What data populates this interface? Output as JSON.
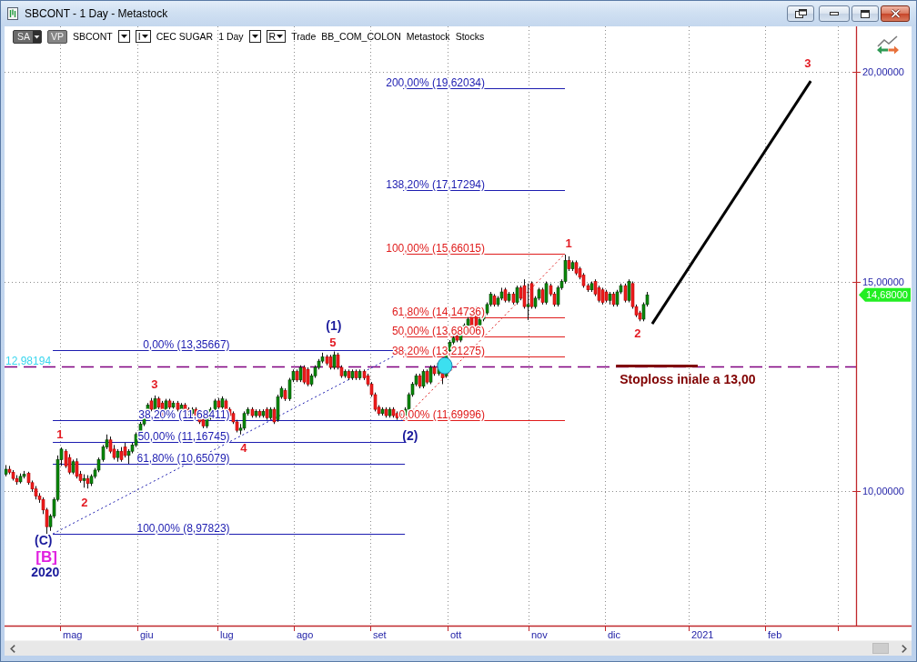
{
  "window": {
    "title": "SBCONT - 1 Day - Metastock"
  },
  "toolbar": [
    {
      "kind": "dark_menu",
      "label": "SA"
    },
    {
      "kind": "tag",
      "label": "VP"
    },
    {
      "kind": "text",
      "label": "SBCONT"
    },
    {
      "kind": "dropdown"
    },
    {
      "kind": "menu",
      "label": "I"
    },
    {
      "kind": "text",
      "label": "CEC SUGAR"
    },
    {
      "kind": "text",
      "label": "1 Day"
    },
    {
      "kind": "dropdown"
    },
    {
      "kind": "menu",
      "label": "R"
    },
    {
      "kind": "text",
      "label": "Trade"
    },
    {
      "kind": "text",
      "label": "BB_COM_COLON"
    },
    {
      "kind": "text",
      "label": "Metastock"
    },
    {
      "kind": "text",
      "label": "Stocks"
    }
  ],
  "chart": {
    "price_axis": {
      "labels": [
        "20,00000",
        "15,00000",
        "10,00000"
      ],
      "last_price": "14,68000"
    },
    "reference_line": {
      "label": "12,98194"
    },
    "fibonacci": [
      {
        "color": "#1c1cb0",
        "levels": [
          {
            "label": "0,00% (13,35667)",
            "color": "#1c1cb0"
          },
          {
            "label": "38,20% (11,68411)",
            "color": "#1c1cb0"
          },
          {
            "label": "50,00% (11,16745)",
            "color": "#1c1cb0"
          },
          {
            "label": "61,80% (10,65079)",
            "color": "#1c1cb0"
          },
          {
            "label": "100,00% (8,97823)",
            "color": "#1c1cb0"
          }
        ]
      },
      {
        "color": "#e01c1c",
        "levels": [
          {
            "label": "200,00% (19,62034)",
            "color": "#1c1cb0"
          },
          {
            "label": "138,20% (17,17294)",
            "color": "#1c1cb0"
          },
          {
            "label": "100,00% (15,66015)",
            "color": "#e01c1c"
          },
          {
            "label": "61,80% (14,14736)",
            "color": "#e01c1c"
          },
          {
            "label": "50,00% (13,68006)",
            "color": "#e01c1c"
          },
          {
            "label": "38,20% (13,21275)",
            "color": "#e01c1c"
          },
          {
            "label": "0,00% (11,69996)",
            "color": "#e01c1c"
          }
        ]
      }
    ],
    "wave_labels": [
      {
        "kind": "intermediate",
        "text": "(C)",
        "color": "#1a1a9c"
      },
      {
        "kind": "primary",
        "text": "[B]",
        "color": "#e020e0"
      },
      {
        "kind": "year",
        "text": "2020",
        "color": "#1a1a9c"
      },
      {
        "kind": "minor",
        "text": "1",
        "color": "#e31b23"
      },
      {
        "kind": "minor",
        "text": "2",
        "color": "#e31b23"
      },
      {
        "kind": "minor",
        "text": "3",
        "color": "#e31b23"
      },
      {
        "kind": "minor",
        "text": "4",
        "color": "#e31b23"
      },
      {
        "kind": "minor",
        "text": "5",
        "color": "#e31b23"
      },
      {
        "kind": "intermediate",
        "text": "(1)",
        "color": "#1a1a9c"
      },
      {
        "kind": "intermediate",
        "text": "(2)",
        "color": "#1a1a9c"
      },
      {
        "kind": "minor",
        "text": "1",
        "color": "#e31b23"
      },
      {
        "kind": "minor",
        "text": "2",
        "color": "#e31b23"
      },
      {
        "kind": "minor",
        "text": "3",
        "color": "#e31b23"
      }
    ],
    "stoploss": {
      "label": "Stoploss iniale a 13,00"
    },
    "time_axis": {
      "labels": [
        "mag",
        "giu",
        "lug",
        "ago",
        "set",
        "ott",
        "nov",
        "dic",
        "2021",
        "feb"
      ]
    }
  }
}
